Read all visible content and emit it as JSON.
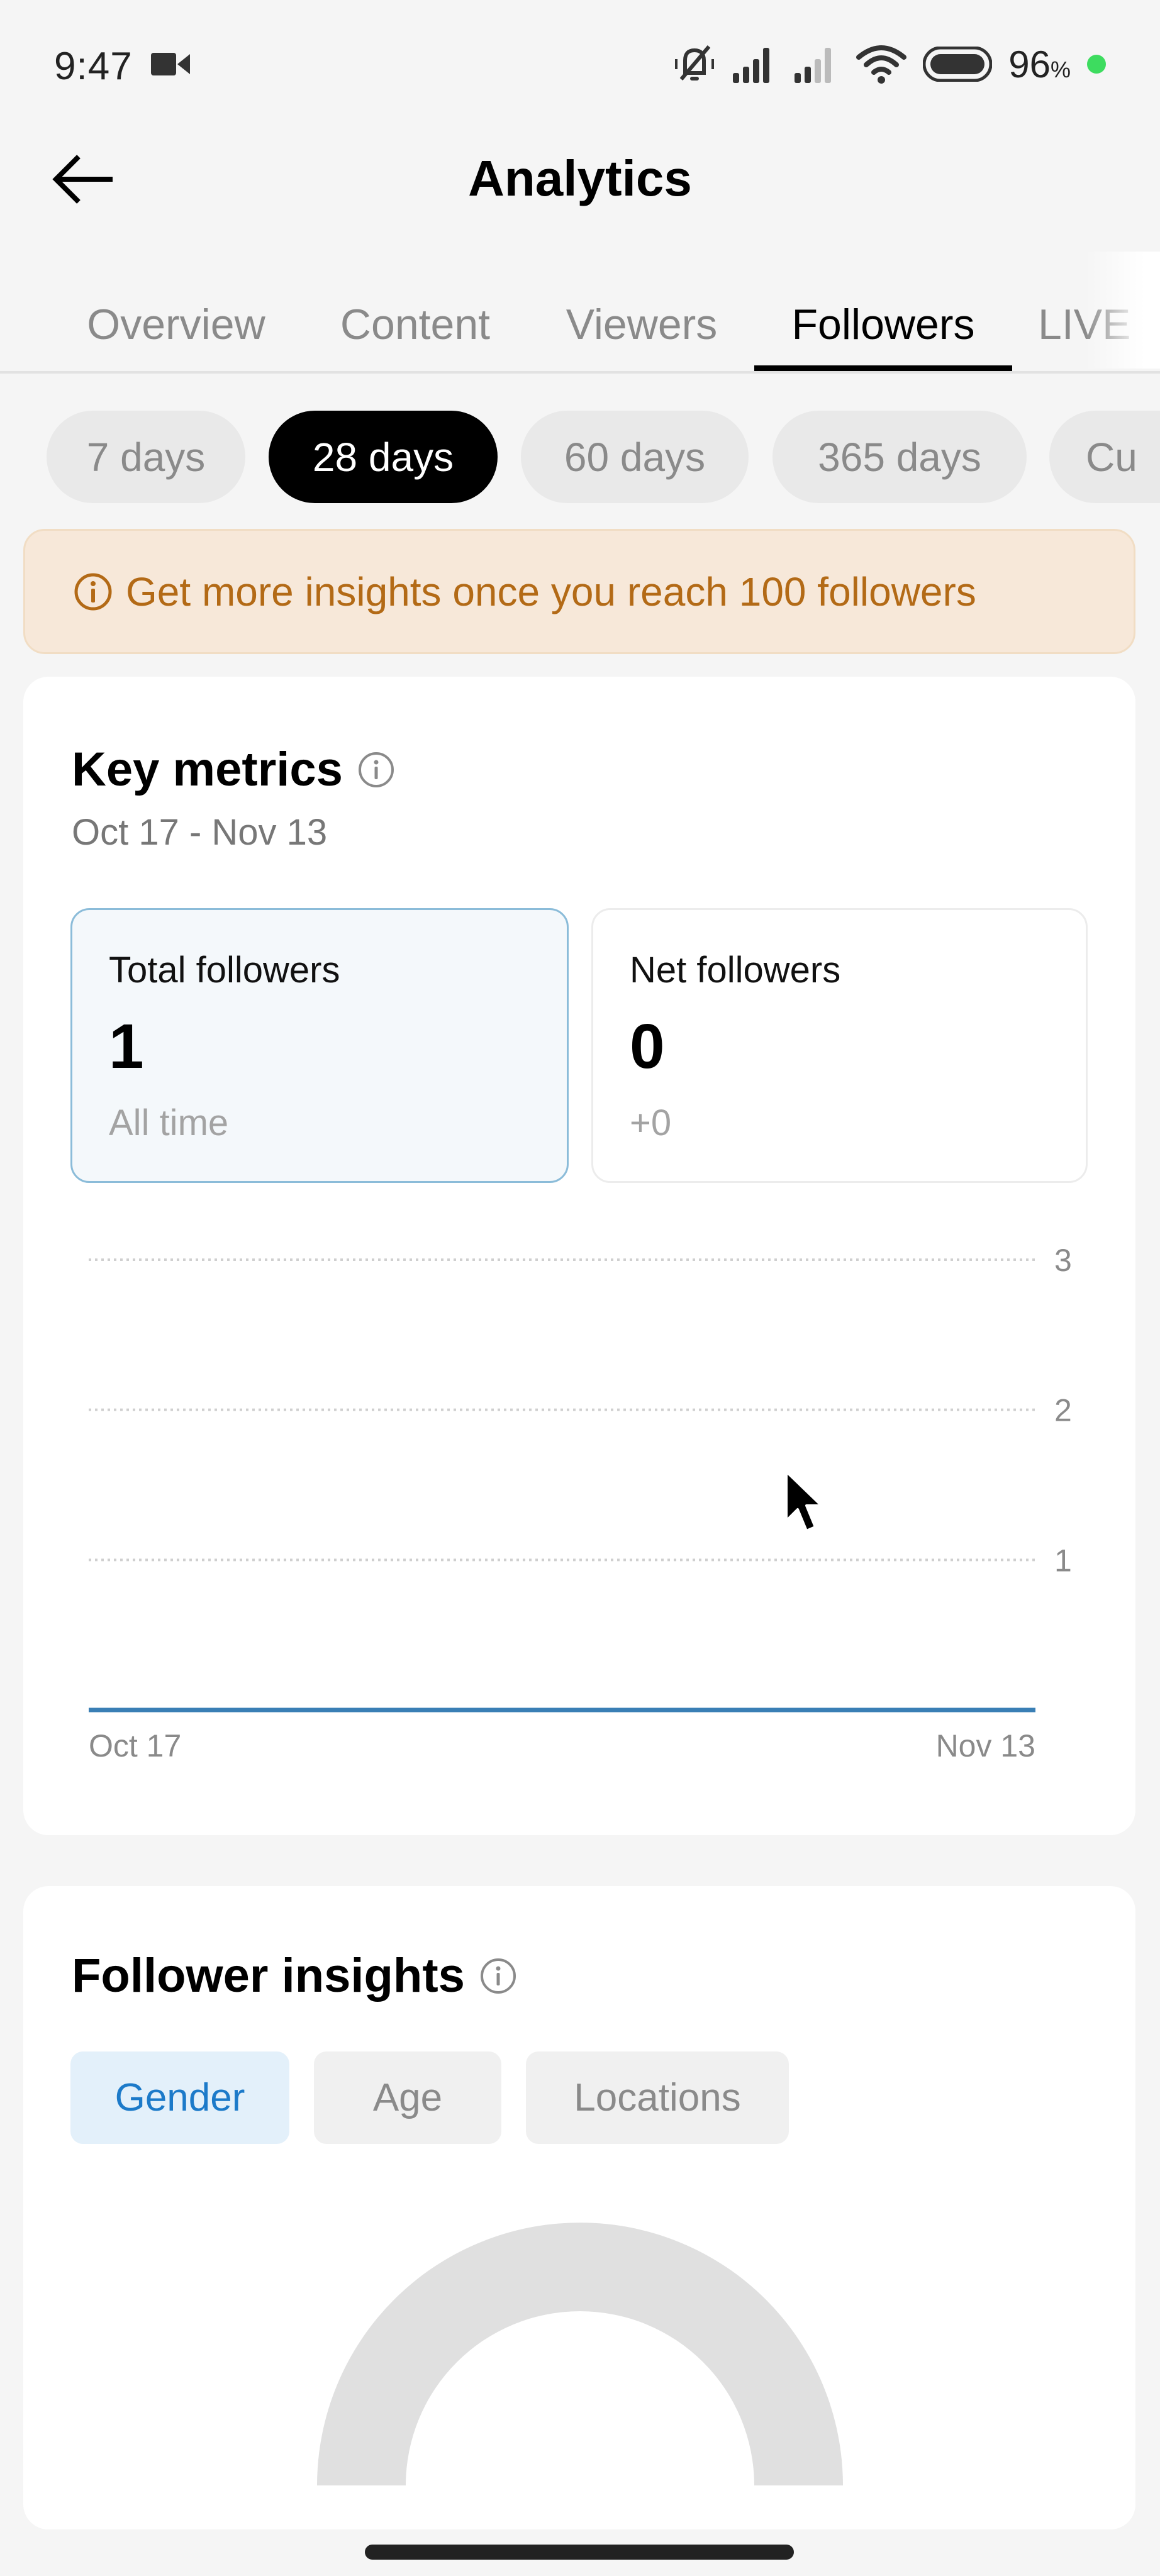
{
  "status_bar": {
    "time": "9:47",
    "battery_percent": "96",
    "battery_unit": "%",
    "icons": [
      "video-camera-icon",
      "silent-bell-icon",
      "signal-icon",
      "signal-weak-icon",
      "wifi-icon",
      "battery-icon"
    ],
    "charging_dot_color": "#3ddc5f"
  },
  "header": {
    "title": "Analytics",
    "back_icon": "back-arrow-icon"
  },
  "tabs": [
    {
      "label": "Overview",
      "active": false
    },
    {
      "label": "Content",
      "active": false
    },
    {
      "label": "Viewers",
      "active": false
    },
    {
      "label": "Followers",
      "active": true
    },
    {
      "label": "LIVE",
      "active": false
    }
  ],
  "date_ranges": [
    {
      "label": "7 days",
      "active": false
    },
    {
      "label": "28 days",
      "active": true
    },
    {
      "label": "60 days",
      "active": false
    },
    {
      "label": "365 days",
      "active": false
    },
    {
      "label": "Cu",
      "active": false
    }
  ],
  "banner": {
    "text": "Get more insights once you reach 100 followers",
    "color": "#b36a16",
    "background": "#f7e8d9"
  },
  "key_metrics": {
    "title": "Key metrics",
    "date_range": "Oct 17 - Nov 13",
    "metrics": [
      {
        "label": "Total followers",
        "value": "1",
        "sub": "All time",
        "selected": true
      },
      {
        "label": "Net followers",
        "value": "0",
        "sub": "+0",
        "selected": false
      }
    ]
  },
  "chart_data": {
    "type": "line",
    "title": "",
    "xlabel": "",
    "ylabel": "",
    "x_tick_labels": [
      "Oct 17",
      "Nov 13"
    ],
    "y_ticks": [
      1,
      2,
      3
    ],
    "ylim": [
      0,
      3
    ],
    "grid": true,
    "series": [
      {
        "name": "Total followers",
        "color": "#3a7fb5",
        "x": [
          "Oct 17",
          "Nov 13"
        ],
        "values": [
          0,
          0
        ]
      }
    ]
  },
  "follower_insights": {
    "title": "Follower insights",
    "tabs": [
      {
        "label": "Gender",
        "active": true
      },
      {
        "label": "Age",
        "active": false
      },
      {
        "label": "Locations",
        "active": false
      }
    ],
    "gauge_color": "#e0e0e0"
  }
}
